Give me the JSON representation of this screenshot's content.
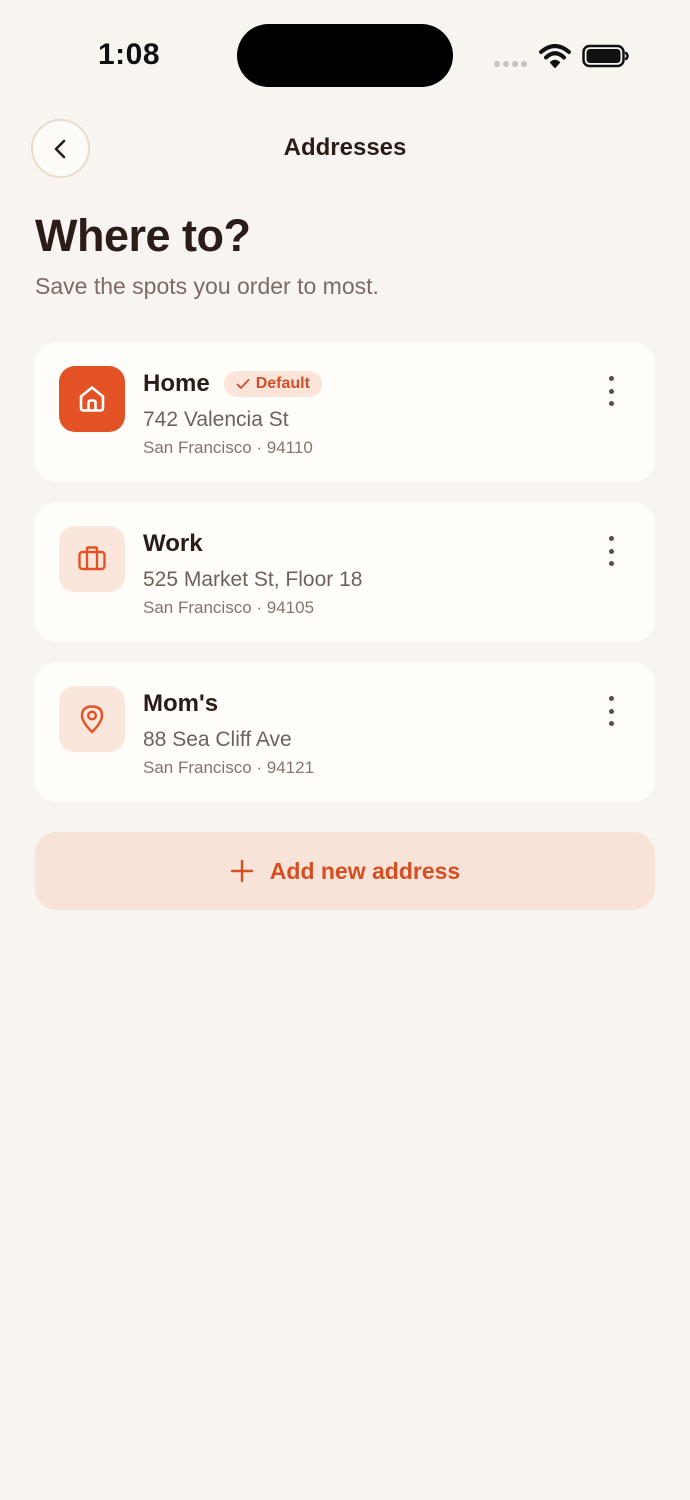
{
  "status_bar": {
    "time": "1:08"
  },
  "header": {
    "title": "Addresses"
  },
  "hero": {
    "title": "Where to?",
    "subtitle": "Save the spots you order to most."
  },
  "addresses": [
    {
      "name": "Home",
      "badge": "Default",
      "street": "742 Valencia St",
      "city": "San Francisco · 94110",
      "icon": "home-icon",
      "is_default": true
    },
    {
      "name": "Work",
      "street": "525 Market St, Floor 18",
      "city": "San Francisco · 94105",
      "icon": "briefcase-icon",
      "is_default": false
    },
    {
      "name": "Mom's",
      "street": "88 Sea Cliff Ave",
      "city": "San Francisco · 94121",
      "icon": "map-pin-icon",
      "is_default": false
    }
  ],
  "add_button": {
    "label": "Add new address",
    "icon": "plus-icon"
  },
  "colors": {
    "accent": "#e35224",
    "accent_text": "#d64f22",
    "accent_soft": "#fbe6dc",
    "background": "#f8f5f1",
    "card": "#fffdfa",
    "text_primary": "#2a1d18",
    "text_secondary": "#6f625c"
  }
}
